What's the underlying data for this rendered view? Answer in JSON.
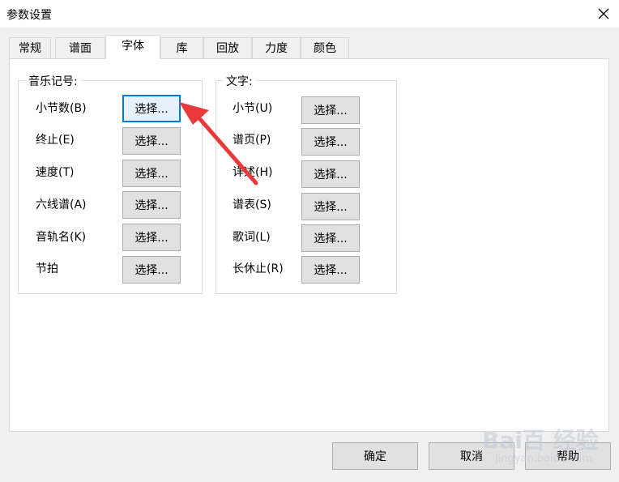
{
  "window": {
    "title": "参数设置"
  },
  "tabs": [
    {
      "label": "常规"
    },
    {
      "label": "谱面"
    },
    {
      "label": "字体",
      "active": true
    },
    {
      "label": "库"
    },
    {
      "label": "回放"
    },
    {
      "label": "力度"
    },
    {
      "label": "颜色"
    }
  ],
  "music_symbols": {
    "title": "音乐记号:",
    "items": [
      {
        "label": "小节数(B)",
        "button": "选择..."
      },
      {
        "label": "终止(E)",
        "button": "选择..."
      },
      {
        "label": "速度(T)",
        "button": "选择..."
      },
      {
        "label": "六线谱(A)",
        "button": "选择..."
      },
      {
        "label": "音轨名(K)",
        "button": "选择..."
      },
      {
        "label": "节拍",
        "button": "选择..."
      }
    ]
  },
  "text_group": {
    "title": "文字:",
    "items": [
      {
        "label": "小节(U)",
        "button": "选择..."
      },
      {
        "label": "谱页(P)",
        "button": "选择..."
      },
      {
        "label": "详述(H)",
        "button": "选择..."
      },
      {
        "label": "谱表(S)",
        "button": "选择..."
      },
      {
        "label": "歌词(L)",
        "button": "选择..."
      },
      {
        "label": "长休止(R)",
        "button": "选择..."
      }
    ]
  },
  "footer": {
    "ok": "确定",
    "cancel": "取消",
    "help": "帮助"
  },
  "watermark": {
    "text": "Bai百 经验",
    "sub": "jingyan.baidu.com"
  },
  "colors": {
    "focus": "#0078d7",
    "arrow": "#e83a3a"
  }
}
